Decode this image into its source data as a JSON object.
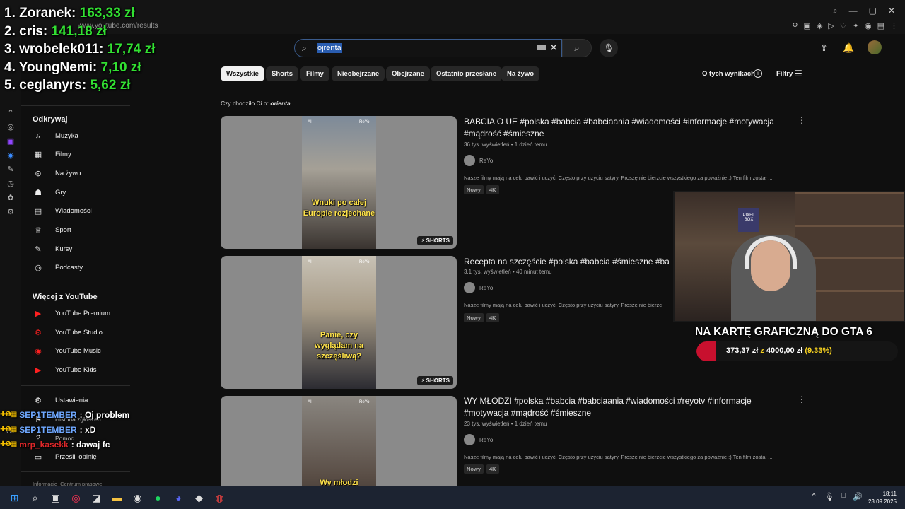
{
  "browser": {
    "url": "www.youtube.com/results"
  },
  "leaderboard": [
    {
      "name": "1. Zoranek:",
      "amount": "163,33 zł"
    },
    {
      "name": "2. cris:",
      "amount": "141,18 zł"
    },
    {
      "name": "3. wrobelek011:",
      "amount": "17,74 zł"
    },
    {
      "name": "4. YoungNemi:",
      "amount": "7,10 zł"
    },
    {
      "name": "5. ceglanyrs:",
      "amount": "5,62 zł"
    }
  ],
  "sidebar": {
    "explore_title": "Odkrywaj",
    "explore": [
      {
        "label": "Muzyka",
        "icon": "music-note-icon"
      },
      {
        "label": "Filmy",
        "icon": "film-icon"
      },
      {
        "label": "Na żywo",
        "icon": "live-icon"
      },
      {
        "label": "Gry",
        "icon": "gamepad-icon"
      },
      {
        "label": "Wiadomości",
        "icon": "news-icon"
      },
      {
        "label": "Sport",
        "icon": "trophy-icon"
      },
      {
        "label": "Kursy",
        "icon": "graduation-icon"
      },
      {
        "label": "Podcasty",
        "icon": "podcast-icon"
      }
    ],
    "more_title": "Więcej z YouTube",
    "more": [
      {
        "label": "YouTube Premium"
      },
      {
        "label": "YouTube Studio"
      },
      {
        "label": "YouTube Music"
      },
      {
        "label": "YouTube Kids"
      }
    ],
    "settings": [
      {
        "label": "Ustawienia"
      },
      {
        "label": "Historia zgłoszeń"
      },
      {
        "label": "Pomoc"
      },
      {
        "label": "Prześlij opinię"
      }
    ],
    "footer": "Informacje  Centrum prasowe"
  },
  "search": {
    "value": "ojrenta"
  },
  "chips": [
    {
      "label": "Wszystkie",
      "active": true
    },
    {
      "label": "Shorts"
    },
    {
      "label": "Filmy"
    },
    {
      "label": "Nieobejrzane"
    },
    {
      "label": "Obejrzane"
    },
    {
      "label": "Ostatnio przesłane"
    },
    {
      "label": "Na żywo"
    }
  ],
  "about_results": "O tych wynikach",
  "filters": "Filtry",
  "did_you_mean": {
    "prefix": "Czy chodziło Ci o:",
    "term": "orienta"
  },
  "results": [
    {
      "title": "BABCIA O UE #polska #babcia #babciaania #wiadomości #informacje #motywacja #mądrość #śmieszne",
      "meta": "36 tys. wyświetleń • 1 dzień temu",
      "channel": "ReYo",
      "desc": "Nasze filmy mają na celu bawić i uczyć. Często przy użyciu satyry. Proszę nie bierzcie wszystkiego za poważnie :) Ten film został ...",
      "tags": [
        "Nowy",
        "4K"
      ],
      "caption": "Wnuki po całej Europie rozjechane",
      "badge": "SHORTS",
      "thumb_ai": "AI",
      "thumb_channel": "ReYo"
    },
    {
      "title": "Recepta na szczęście #polska #babcia #śmieszne #ba",
      "meta": "3,1 tys. wyświetleń • 40 minut temu",
      "channel": "ReYo",
      "desc": "Nasze filmy mają na celu bawić i uczyć. Często przy użyciu satyry. Proszę nie bierzc",
      "tags": [
        "Nowy",
        "4K"
      ],
      "caption": "Panie, czy wyglądam na szczęśliwą?",
      "badge": "SHORTS",
      "thumb_ai": "AI",
      "thumb_channel": "ReYo"
    },
    {
      "title": "WY MŁODZI #polska #babcia #babciaania #wiadomości #reyotv #informacje #motywacja #mądrość #śmieszne",
      "meta": "23 tys. wyświetleń • 1 dzień temu",
      "channel": "ReYo",
      "desc": "Nasze filmy mają na celu bawić i uczyć. Często przy użyciu satyry. Proszę nie bierzcie wszystkiego za poważnie :) Ten film został ...",
      "tags": [
        "Nowy",
        "4K"
      ],
      "caption": "Wy młodzi",
      "badge": "",
      "thumb_ai": "AI",
      "thumb_channel": "ReYo"
    }
  ],
  "webcam": {
    "shelf_label": "PIXEL BOX"
  },
  "donation": {
    "title": "NA KARTĘ GRAFICZNĄ DO GTA 6",
    "current": "373,37 zł",
    "sep": "z",
    "goal": "4000,00 zł",
    "percent": "(9.33%)",
    "fill_fraction": 0.0933,
    "fill_color": "#c8102e"
  },
  "chat": [
    {
      "user": "SEP1TEMBER",
      "sep": ":",
      "message": "Oj problem",
      "color": "#6fa8ff"
    },
    {
      "user": "SEP1TEMBER",
      "sep": ":",
      "message": "xD",
      "color": "#6fa8ff"
    },
    {
      "user": "mrp_kasekk",
      "sep": ":",
      "message": "dawaj fc",
      "color": "#e0282a"
    }
  ],
  "taskbar": {
    "time": "18:11",
    "date": "23.09.2025"
  }
}
